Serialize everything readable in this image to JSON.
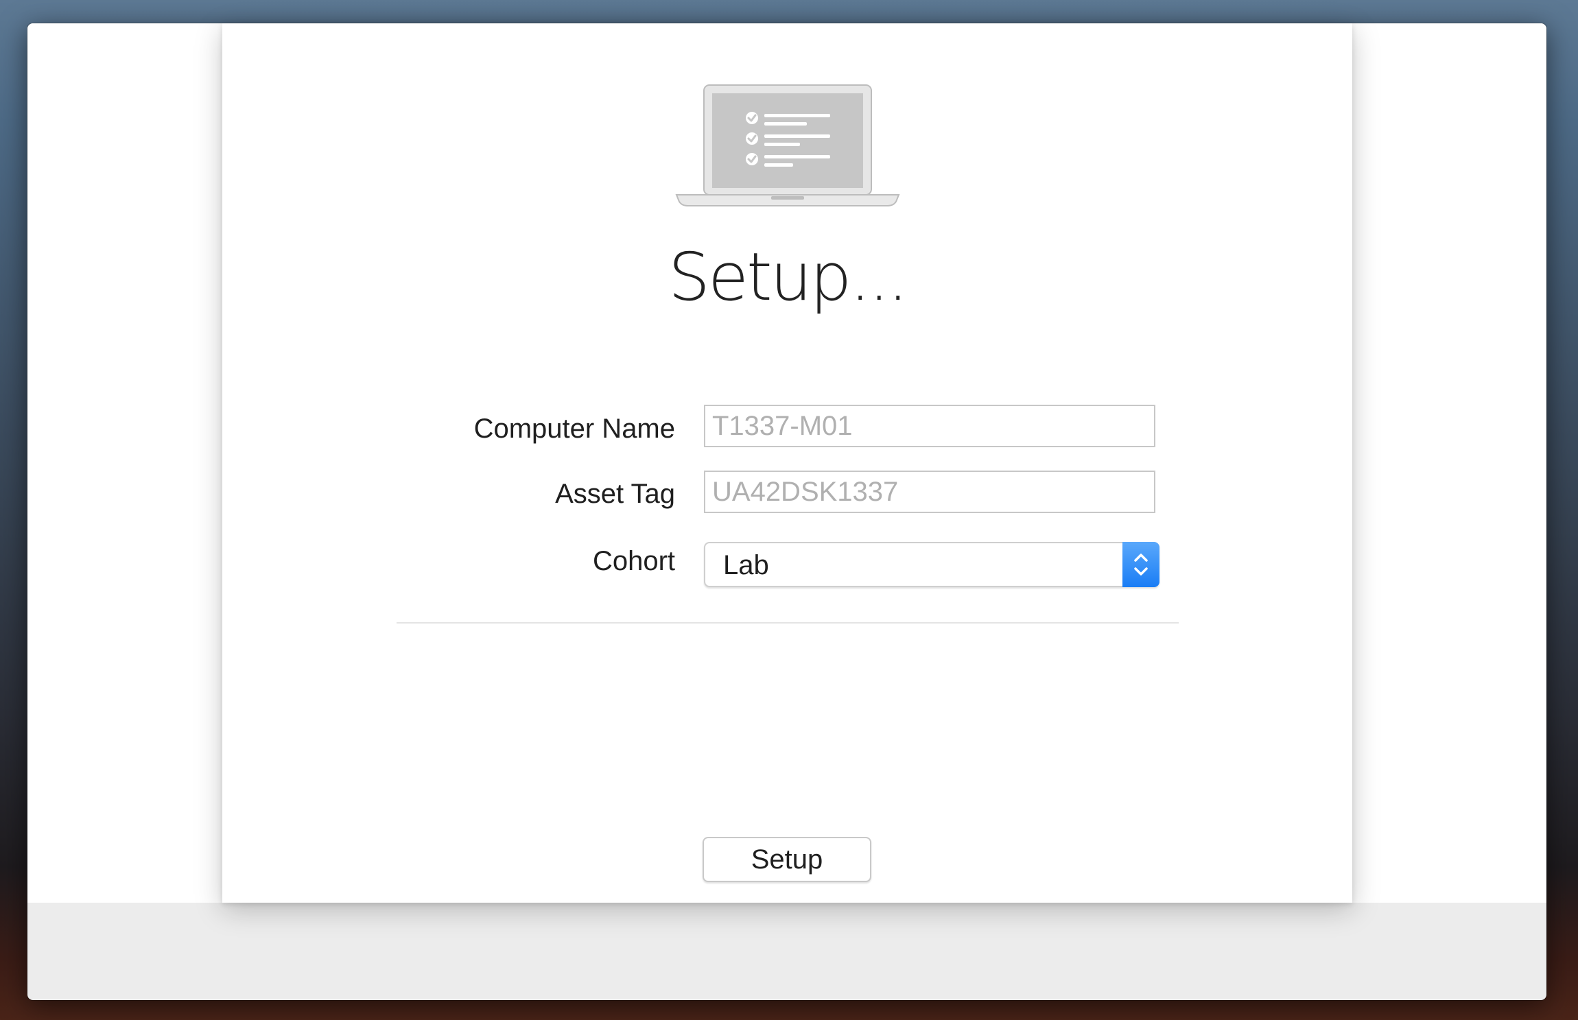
{
  "dialog": {
    "title": "Setup...",
    "hero_icon": "laptop-checklist-icon"
  },
  "form": {
    "computer_name": {
      "label": "Computer Name",
      "placeholder": "T1337-M01",
      "value": ""
    },
    "asset_tag": {
      "label": "Asset Tag",
      "placeholder": "UA42DSK1337",
      "value": ""
    },
    "cohort": {
      "label": "Cohort",
      "selected": "Lab",
      "icon": "up-down-chevron-icon"
    }
  },
  "actions": {
    "setup_label": "Setup"
  },
  "colors": {
    "accent": "#1a7df5",
    "sheet_background": "#ffffff",
    "footer_background": "#ececec"
  }
}
